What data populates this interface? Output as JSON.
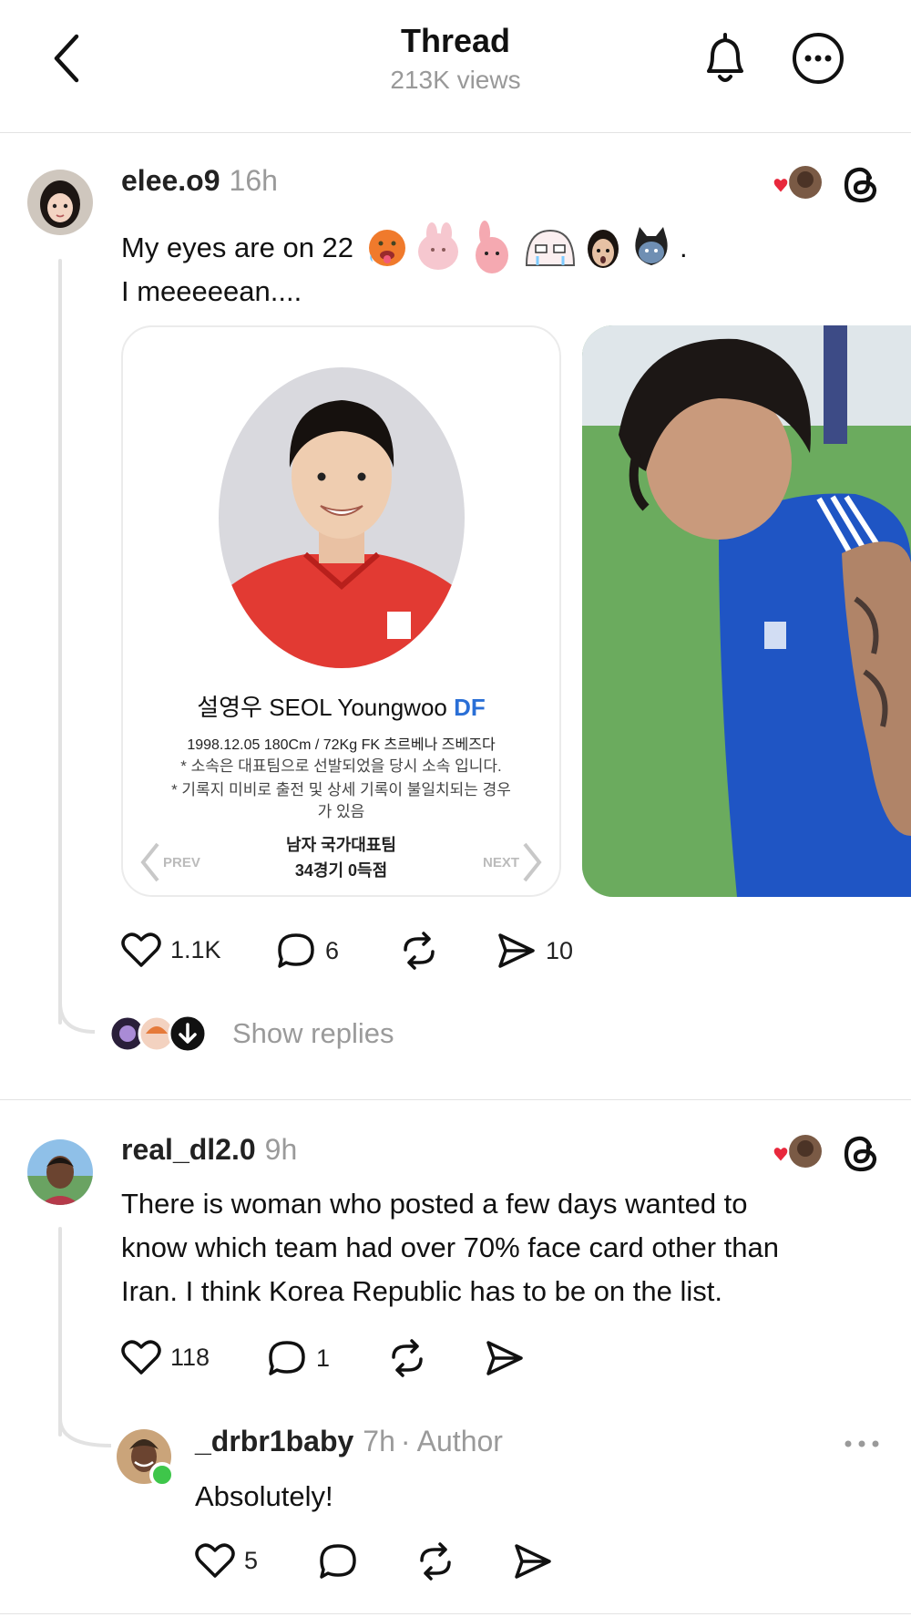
{
  "header": {
    "title": "Thread",
    "views": "213K views"
  },
  "posts": [
    {
      "username": "elee.o9",
      "time": "16h",
      "text_line1": "My eyes are on 22",
      "text_line1_end": ".",
      "text_line2": "I meeeeean....",
      "card": {
        "name_ko": "설영우",
        "name_en": "SEOL Youngwoo",
        "position": "DF",
        "info": "1998.12.05 180Cm / 72Kg FK 츠르베나 즈베즈다",
        "note1": "* 소속은 대표팀으로 선발되었을 당시 소속 입니다.",
        "note2": "* 기록지 미비로 출전 및 상세 기록이 불일치되는 경우가 있음",
        "team": "남자 국가대표팀",
        "record": "34경기 0득점",
        "prev": "PREV",
        "next": "NEXT"
      },
      "likes": "1.1K",
      "comments": "6",
      "shares": "10",
      "show_replies": "Show replies"
    },
    {
      "username": "real_dl2.0",
      "time": "9h",
      "text_line1": "There is woman who posted a few days wanted to",
      "text_line2": "know which team had over 70% face card other than",
      "text_line3": "Iran. I think Korea Republic has to be on the list.",
      "likes": "118",
      "comments": "1"
    },
    {
      "username": "_drbr1baby",
      "time": "7h",
      "author": "· Author",
      "text": "Absolutely!",
      "likes": "5"
    }
  ],
  "colors": {
    "accent_blue": "#2a6fd6",
    "heart_red": "#e8283c",
    "online_green": "#3ec64a",
    "muted": "#9a9a9a"
  },
  "icons": [
    "back-icon",
    "bell-icon",
    "more-icon",
    "threads-logo-icon",
    "heart-icon",
    "comment-icon",
    "repost-icon",
    "share-icon",
    "arrow-down-icon"
  ]
}
